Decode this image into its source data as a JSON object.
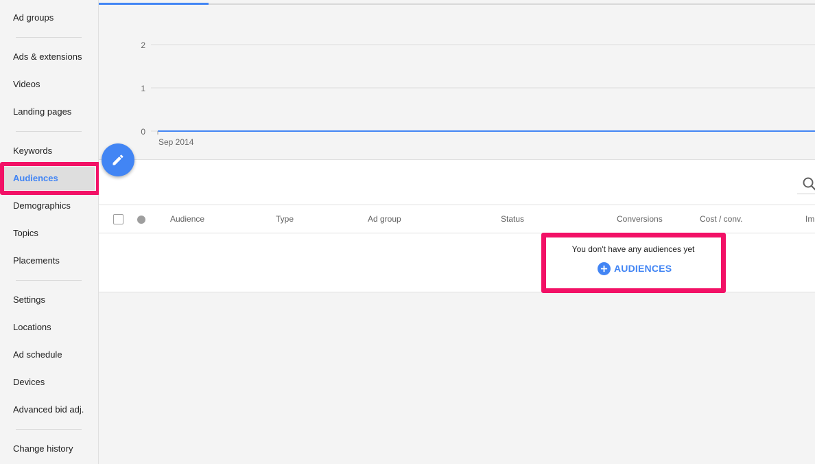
{
  "sidebar": {
    "items": [
      {
        "label": "Ad groups",
        "active": false
      },
      {
        "label": "Ads & extensions",
        "active": false
      },
      {
        "label": "Videos",
        "active": false
      },
      {
        "label": "Landing pages",
        "active": false
      },
      {
        "label": "Keywords",
        "active": false
      },
      {
        "label": "Audiences",
        "active": true
      },
      {
        "label": "Demographics",
        "active": false
      },
      {
        "label": "Topics",
        "active": false
      },
      {
        "label": "Placements",
        "active": false
      },
      {
        "label": "Settings",
        "active": false
      },
      {
        "label": "Locations",
        "active": false
      },
      {
        "label": "Ad schedule",
        "active": false
      },
      {
        "label": "Devices",
        "active": false
      },
      {
        "label": "Advanced bid adj.",
        "active": false
      },
      {
        "label": "Change history",
        "active": false
      }
    ]
  },
  "chart": {
    "y_ticks": [
      "2",
      "1",
      "0"
    ],
    "x_label": "Sep 2014"
  },
  "chart_data": {
    "type": "line",
    "x": [
      "Sep 2014"
    ],
    "series": [
      {
        "values": [
          0
        ]
      }
    ],
    "ylim": [
      0,
      2
    ],
    "grid": true
  },
  "fab": {
    "icon": "pencil-icon"
  },
  "table": {
    "search_icon": "search-icon",
    "columns": [
      "Audience",
      "Type",
      "Ad group",
      "Status",
      "Conversions",
      "Cost / conv.",
      "Im"
    ],
    "empty_message": "You don't have any audiences yet",
    "add_button_label": "AUDIENCES"
  },
  "colors": {
    "accent": "#4285f4",
    "highlight": "#f21166"
  }
}
